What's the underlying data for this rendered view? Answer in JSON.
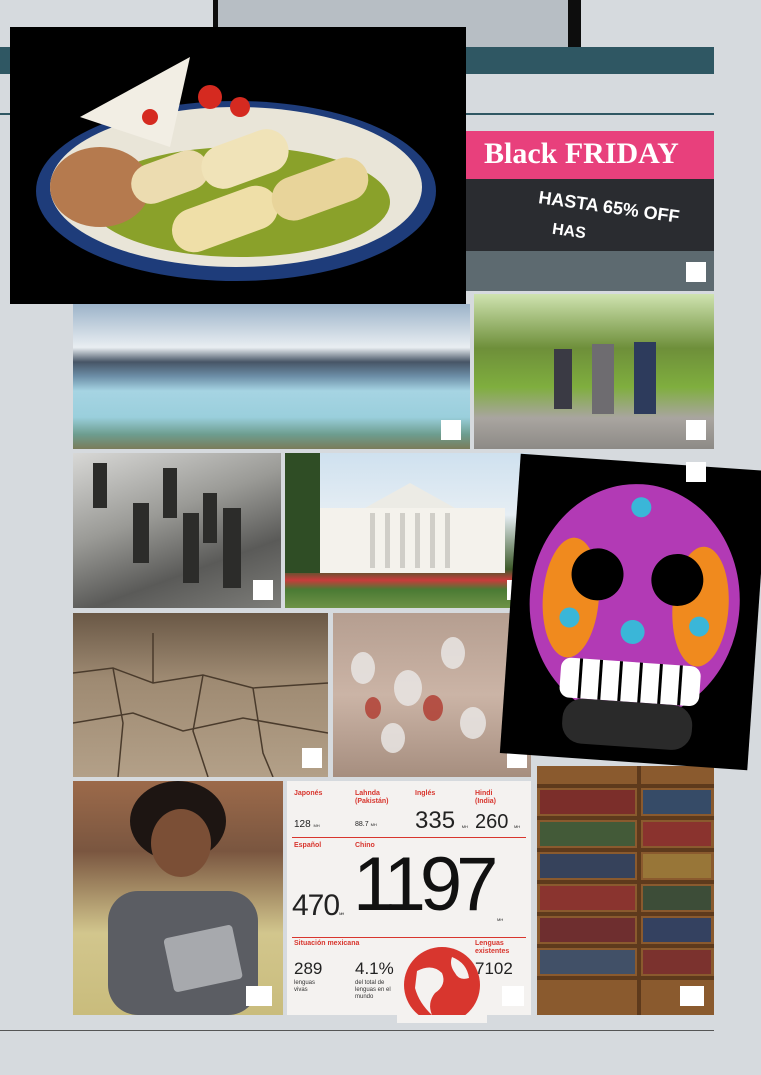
{
  "colors": {
    "page_bg": "#d6dade",
    "band": "#2f5763",
    "accent_red": "#d8362e"
  },
  "photos": [
    {
      "name": "enchiladas-photo"
    },
    {
      "name": "black-friday-photo"
    },
    {
      "name": "glacier-photo"
    },
    {
      "name": "park-walkers-photo"
    },
    {
      "name": "revolution-soldiers-photo"
    },
    {
      "name": "white-house-photo"
    },
    {
      "name": "sugar-skull-photo"
    },
    {
      "name": "dry-earth-photo"
    },
    {
      "name": "cave-hands-photo"
    },
    {
      "name": "student-tablet-photo"
    },
    {
      "name": "bookshelf-photo"
    }
  ],
  "black_friday": {
    "banner": "Black FRIDAY",
    "line1": "HASTA 65% OFF",
    "line2": "HAS"
  },
  "languages": {
    "japones": {
      "label": "Japonés",
      "value": "128",
      "unit": "MH"
    },
    "lahnda": {
      "label": "Lahnda (Pakistán)",
      "value": "88.7",
      "unit": "MH"
    },
    "ingles": {
      "label": "Inglés",
      "value": "335",
      "unit": "MH"
    },
    "hindi": {
      "label": "Hindi (India)",
      "value": "260",
      "unit": "MH"
    },
    "espanol": {
      "label": "Español",
      "value": "470",
      "unit": "MH"
    },
    "chino": {
      "label": "Chino",
      "value": "1197",
      "unit": "MH"
    },
    "situacion": {
      "label": "Situación mexicana"
    },
    "vivas": {
      "value": "289",
      "text": "lenguas vivas"
    },
    "porcentaje": {
      "value": "4.1%",
      "text": "del total de lenguas en el mundo"
    },
    "existentes": {
      "label": "Lenguas existentes",
      "value": "7102"
    }
  }
}
